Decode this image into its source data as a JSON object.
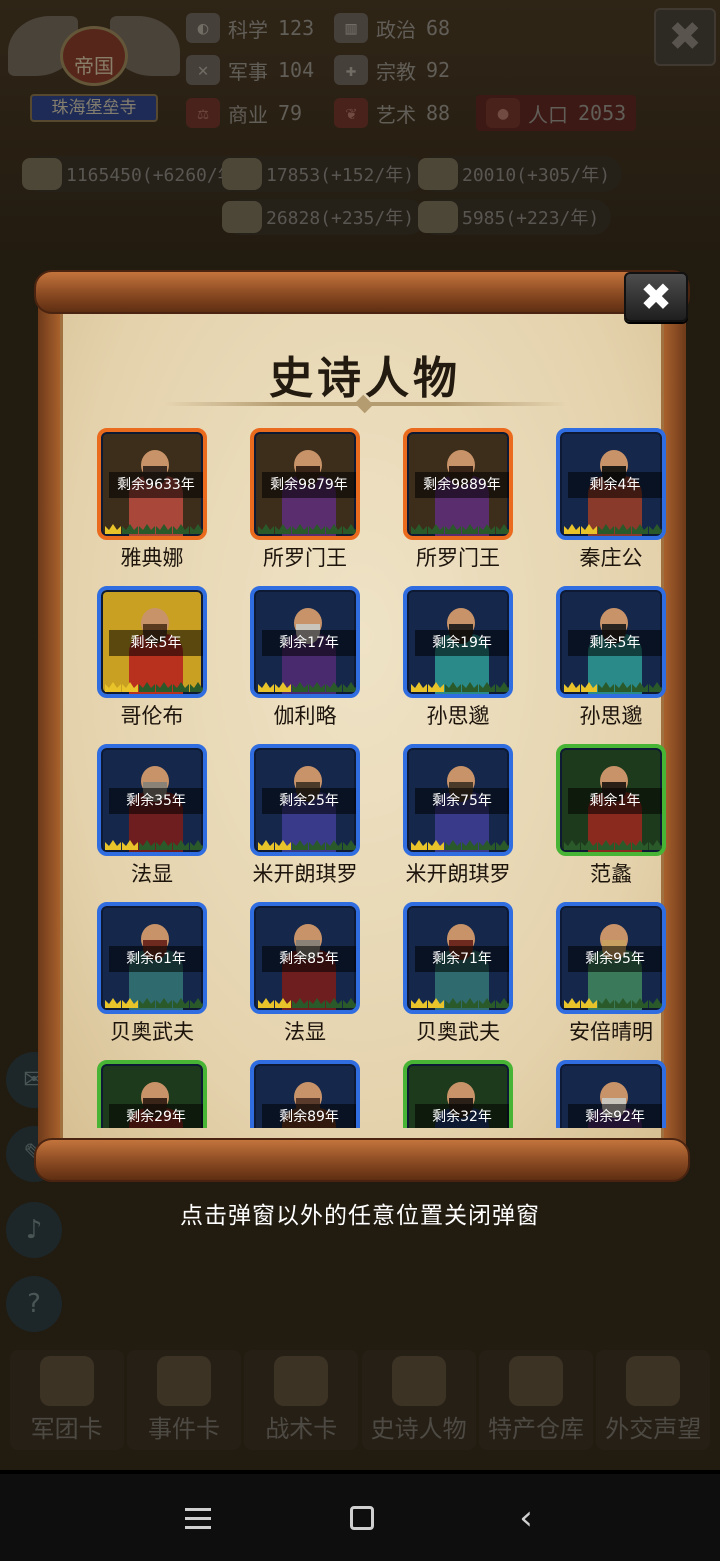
{
  "background": {
    "emblem": {
      "tier": "帝国",
      "city": "珠海堡垒寺"
    },
    "stats": [
      {
        "icon": "science-icon",
        "name": "科学",
        "value": "123"
      },
      {
        "icon": "politics-icon",
        "name": "政治",
        "value": "68"
      },
      {
        "icon": "military-icon",
        "name": "军事",
        "value": "104"
      },
      {
        "icon": "religion-icon",
        "name": "宗教",
        "value": "92"
      },
      {
        "icon": "commerce-icon",
        "name": "商业",
        "value": "79"
      },
      {
        "icon": "art-icon",
        "name": "艺术",
        "value": "88"
      },
      {
        "icon": "population-icon",
        "name": "人口",
        "value": "2053"
      }
    ],
    "resources": [
      {
        "icon": "gold-icon",
        "text": "1165450(+6260/年"
      },
      {
        "icon": "wood-icon",
        "text": "17853(+152/年)"
      },
      {
        "icon": "stone-icon",
        "text": "20010(+305/年)"
      },
      {
        "icon": "iron-icon",
        "text": "26828(+235/年)"
      },
      {
        "icon": "meat-icon",
        "text": "5985(+223/年)"
      }
    ],
    "close_label": "✖",
    "bottom_nav": [
      {
        "icon": "helmet-icon",
        "label": "军团卡"
      },
      {
        "icon": "scroll-icon",
        "label": "事件卡"
      },
      {
        "icon": "shield-crest-icon",
        "label": "战术卡"
      },
      {
        "icon": "crown-icon",
        "label": "史诗人物"
      },
      {
        "icon": "chest-icon",
        "label": "特产仓库"
      },
      {
        "icon": "letter-icon",
        "label": "外交声望"
      }
    ],
    "side_buttons": [
      "chat-icon",
      "wrench-icon",
      "mute-icon",
      "help-icon"
    ],
    "help_glyph": "?"
  },
  "popup": {
    "title": "史诗人物",
    "close_label": "✖",
    "figures": [
      {
        "name": "雅典娜",
        "timer": "剩余9633年",
        "frame": "orange",
        "crowns": 1,
        "robe": "#a9483a",
        "beard": "#3a2a20",
        "bg": ""
      },
      {
        "name": "所罗门王",
        "timer": "剩余9879年",
        "frame": "orange",
        "crowns": 0,
        "robe": "#5a2d6e",
        "beard": "#3a2418",
        "bg": ""
      },
      {
        "name": "所罗门王",
        "timer": "剩余9889年",
        "frame": "orange",
        "crowns": 0,
        "robe": "#5a2d6e",
        "beard": "#3a2418",
        "bg": ""
      },
      {
        "name": "秦庄公",
        "timer": "剩余4年",
        "frame": "blue",
        "crowns": 2,
        "robe": "#8a3a2a",
        "beard": "#1e1a16",
        "bg": ""
      },
      {
        "name": "哥伦布",
        "timer": "剩余5年",
        "frame": "blue",
        "crowns": 2,
        "robe": "#b8301e",
        "beard": "#5a3a1e",
        "bg": "gold"
      },
      {
        "name": "伽利略",
        "timer": "剩余17年",
        "frame": "blue",
        "crowns": 2,
        "robe": "#4a2a6e",
        "beard": "#c9c4bc",
        "bg": ""
      },
      {
        "name": "孙思邈",
        "timer": "剩余19年",
        "frame": "blue",
        "crowns": 2,
        "robe": "#2a8a8a",
        "beard": "#2a2420",
        "bg": ""
      },
      {
        "name": "孙思邈",
        "timer": "剩余5年",
        "frame": "blue",
        "crowns": 2,
        "robe": "#2a8a8a",
        "beard": "#2a2420",
        "bg": ""
      },
      {
        "name": "法显",
        "timer": "剩余35年",
        "frame": "blue",
        "crowns": 2,
        "robe": "#6e1e1e",
        "beard": "#8a8276",
        "bg": ""
      },
      {
        "name": "米开朗琪罗",
        "timer": "剩余25年",
        "frame": "blue",
        "crowns": 2,
        "robe": "#3a3a8a",
        "beard": "#4a3a2a",
        "bg": ""
      },
      {
        "name": "米开朗琪罗",
        "timer": "剩余75年",
        "frame": "blue",
        "crowns": 2,
        "robe": "#3a3a8a",
        "beard": "#4a3a2a",
        "bg": ""
      },
      {
        "name": "范蠡",
        "timer": "剩余1年",
        "frame": "green",
        "crowns": 0,
        "robe": "#8a2a1e",
        "beard": "#2a2018",
        "bg": ""
      },
      {
        "name": "贝奥武夫",
        "timer": "剩余61年",
        "frame": "blue",
        "crowns": 2,
        "robe": "#2e6a6e",
        "beard": "#6e2a1e",
        "bg": ""
      },
      {
        "name": "法显",
        "timer": "剩余85年",
        "frame": "blue",
        "crowns": 2,
        "robe": "#6e1e1e",
        "beard": "#8a8276",
        "bg": ""
      },
      {
        "name": "贝奥武夫",
        "timer": "剩余71年",
        "frame": "blue",
        "crowns": 2,
        "robe": "#2e6a6e",
        "beard": "#6e2a1e",
        "bg": ""
      },
      {
        "name": "安倍晴明",
        "timer": "剩余95年",
        "frame": "blue",
        "crowns": 2,
        "robe": "#3a7a5a",
        "beard": "#c9a060",
        "bg": ""
      },
      {
        "name": "",
        "timer": "剩余29年",
        "frame": "green",
        "crowns": 0,
        "robe": "#8a2a1e",
        "beard": "#3a2418",
        "bg": ""
      },
      {
        "name": "",
        "timer": "剩余89年",
        "frame": "blue",
        "crowns": 0,
        "robe": "#6e3a1e",
        "beard": "#5a3a2a",
        "bg": ""
      },
      {
        "name": "",
        "timer": "剩余32年",
        "frame": "green",
        "crowns": 0,
        "robe": "#1e3a6e",
        "beard": "#2a2018",
        "bg": ""
      },
      {
        "name": "",
        "timer": "剩余92年",
        "frame": "blue",
        "crowns": 0,
        "robe": "#4a2a6e",
        "beard": "#c9c4bc",
        "bg": ""
      }
    ]
  },
  "hint": "点击弹窗以外的任意位置关闭弹窗",
  "system_nav": {
    "back_glyph": "‹"
  }
}
